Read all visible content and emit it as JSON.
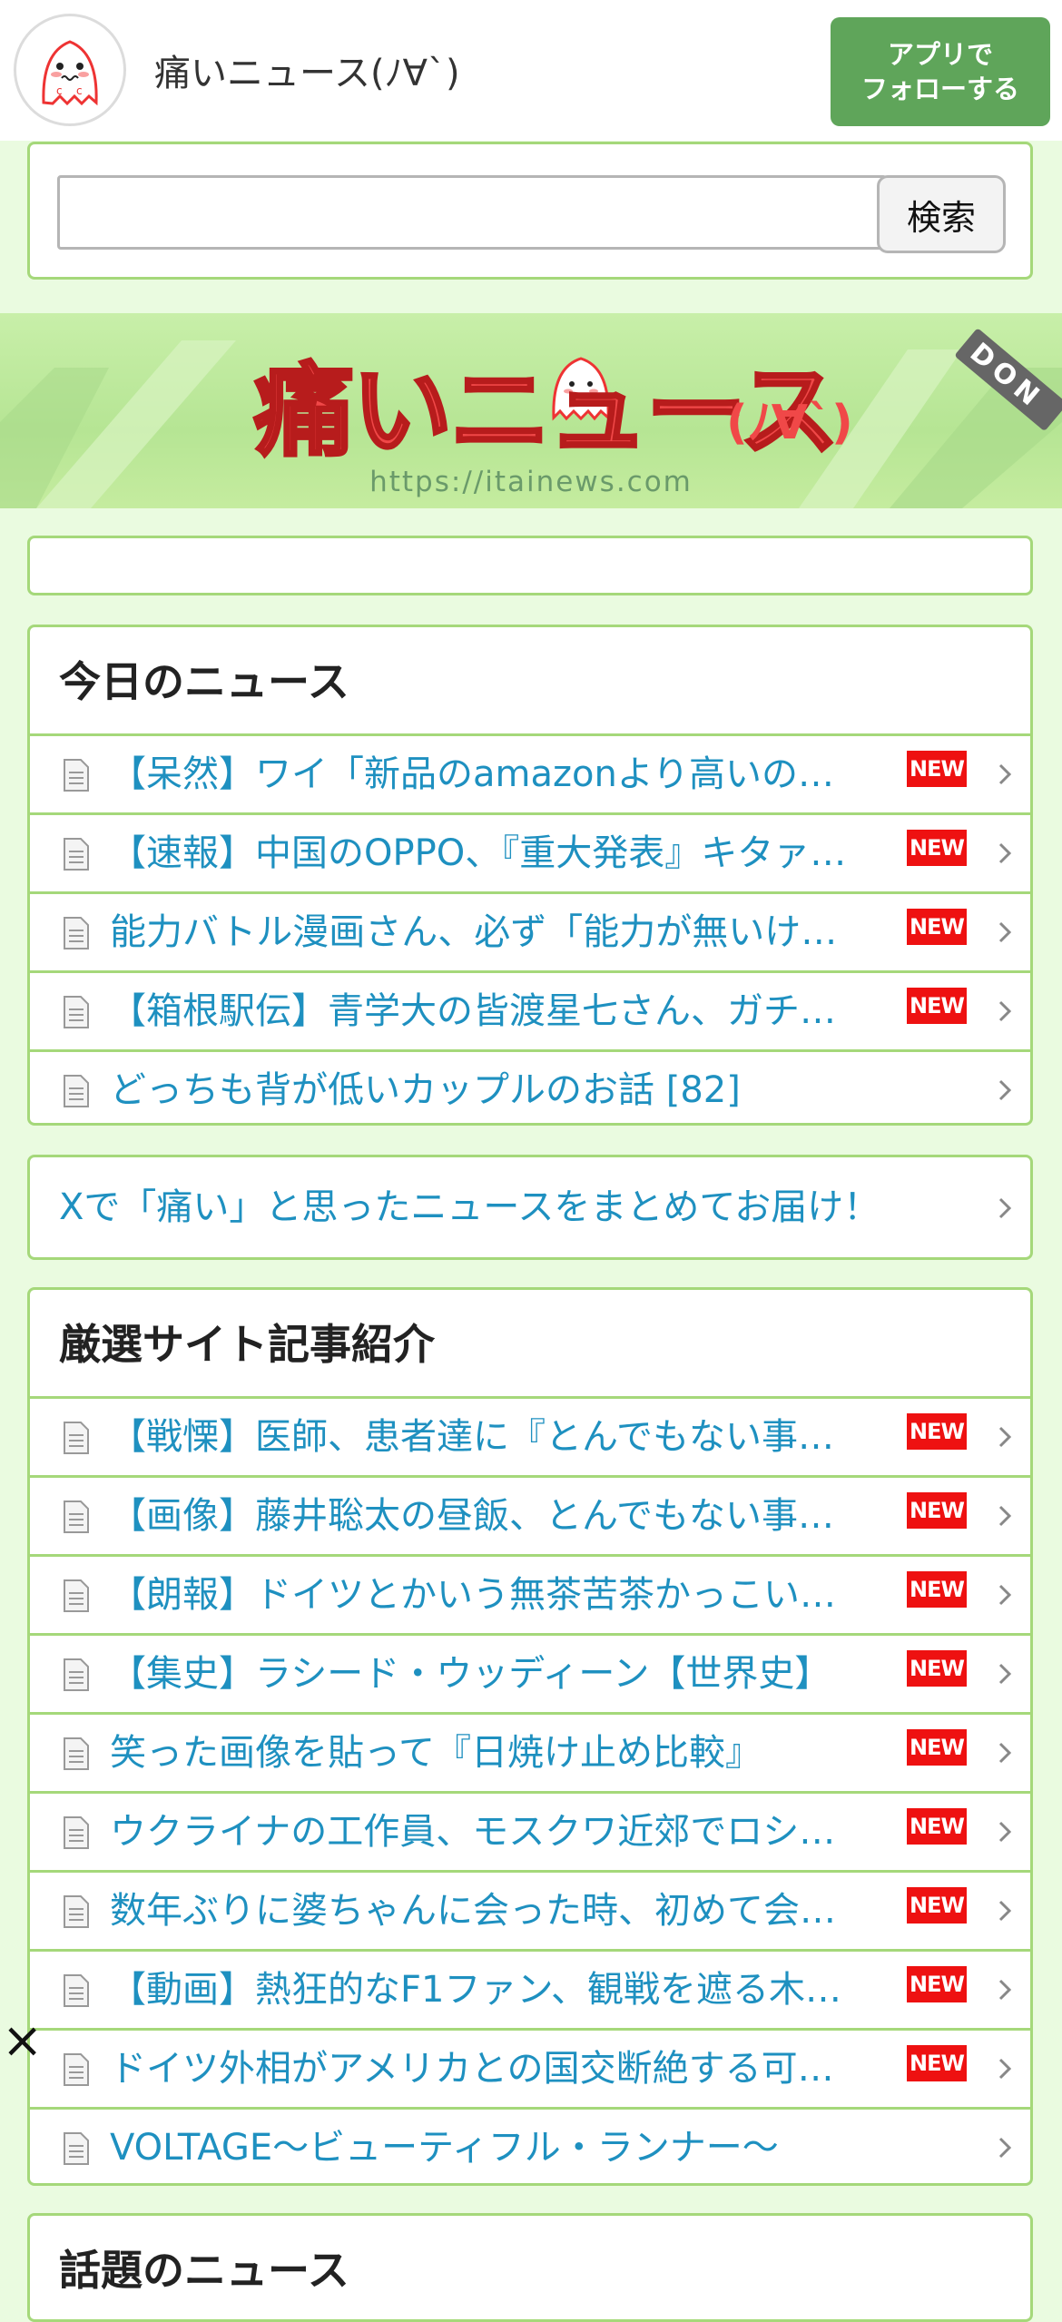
{
  "header": {
    "site_title": "痛いニュース(ﾉ∀`)",
    "follow_line1": "アプリで",
    "follow_line2": "フォローする"
  },
  "search": {
    "button_label": "検索",
    "input_value": "",
    "placeholder": ""
  },
  "banner": {
    "logo_text": "痛いニュース",
    "logo_suffix": "(ﾉ∀`)",
    "url": "https://itainews.com",
    "corner_text": "DON"
  },
  "today_news": {
    "title": "今日のニュース",
    "items": [
      {
        "text": "【呆然】ワイ「新品のamazonより高いの…",
        "new": true
      },
      {
        "text": "【速報】中国のOPPO、『重大発表』キタァ…",
        "new": true
      },
      {
        "text": "能力バトル漫画さん、必ず「能力が無いけ…",
        "new": true
      },
      {
        "text": "【箱根駅伝】青学大の皆渡星七さん、ガチ…",
        "new": true
      },
      {
        "text": "どっちも背が低いカップルのお話 [82]",
        "new": false
      }
    ]
  },
  "twitter": {
    "text": "Xで「痛い」と思ったニュースをまとめてお届け！"
  },
  "selected_sites": {
    "title": "厳選サイト記事紹介",
    "items": [
      {
        "text": "【戦慄】医師、患者達に『とんでもない事…",
        "new": true
      },
      {
        "text": "【画像】藤井聡太の昼飯、とんでもない事…",
        "new": true
      },
      {
        "text": "【朗報】ドイツとかいう無茶苦茶かっこい…",
        "new": true
      },
      {
        "text": "【集史】ラシード・ウッディーン【世界史】",
        "new": true
      },
      {
        "text": "笑った画像を貼って『日焼け止め比較』",
        "new": true
      },
      {
        "text": "ウクライナの工作員、モスクワ近郊でロシ…",
        "new": true
      },
      {
        "text": "数年ぶりに婆ちゃんに会った時、初めて会…",
        "new": true
      },
      {
        "text": "【動画】熱狂的なF1ファン、観戦を遮る木…",
        "new": true
      },
      {
        "text": "ドイツ外相がアメリカとの国交断絶する可…",
        "new": true
      },
      {
        "text": "VOLTAGE〜ビューティフル・ランナー〜",
        "new": false
      }
    ]
  },
  "trending": {
    "title": "話題のニュース"
  },
  "new_badge_label": "NEW",
  "close_label": "×",
  "colors": {
    "accent_green": "#5fa55a",
    "border_green": "#a5d87a",
    "link_blue": "#1e90c0",
    "new_red": "#ee1111",
    "page_bg": "#eafbe0"
  }
}
